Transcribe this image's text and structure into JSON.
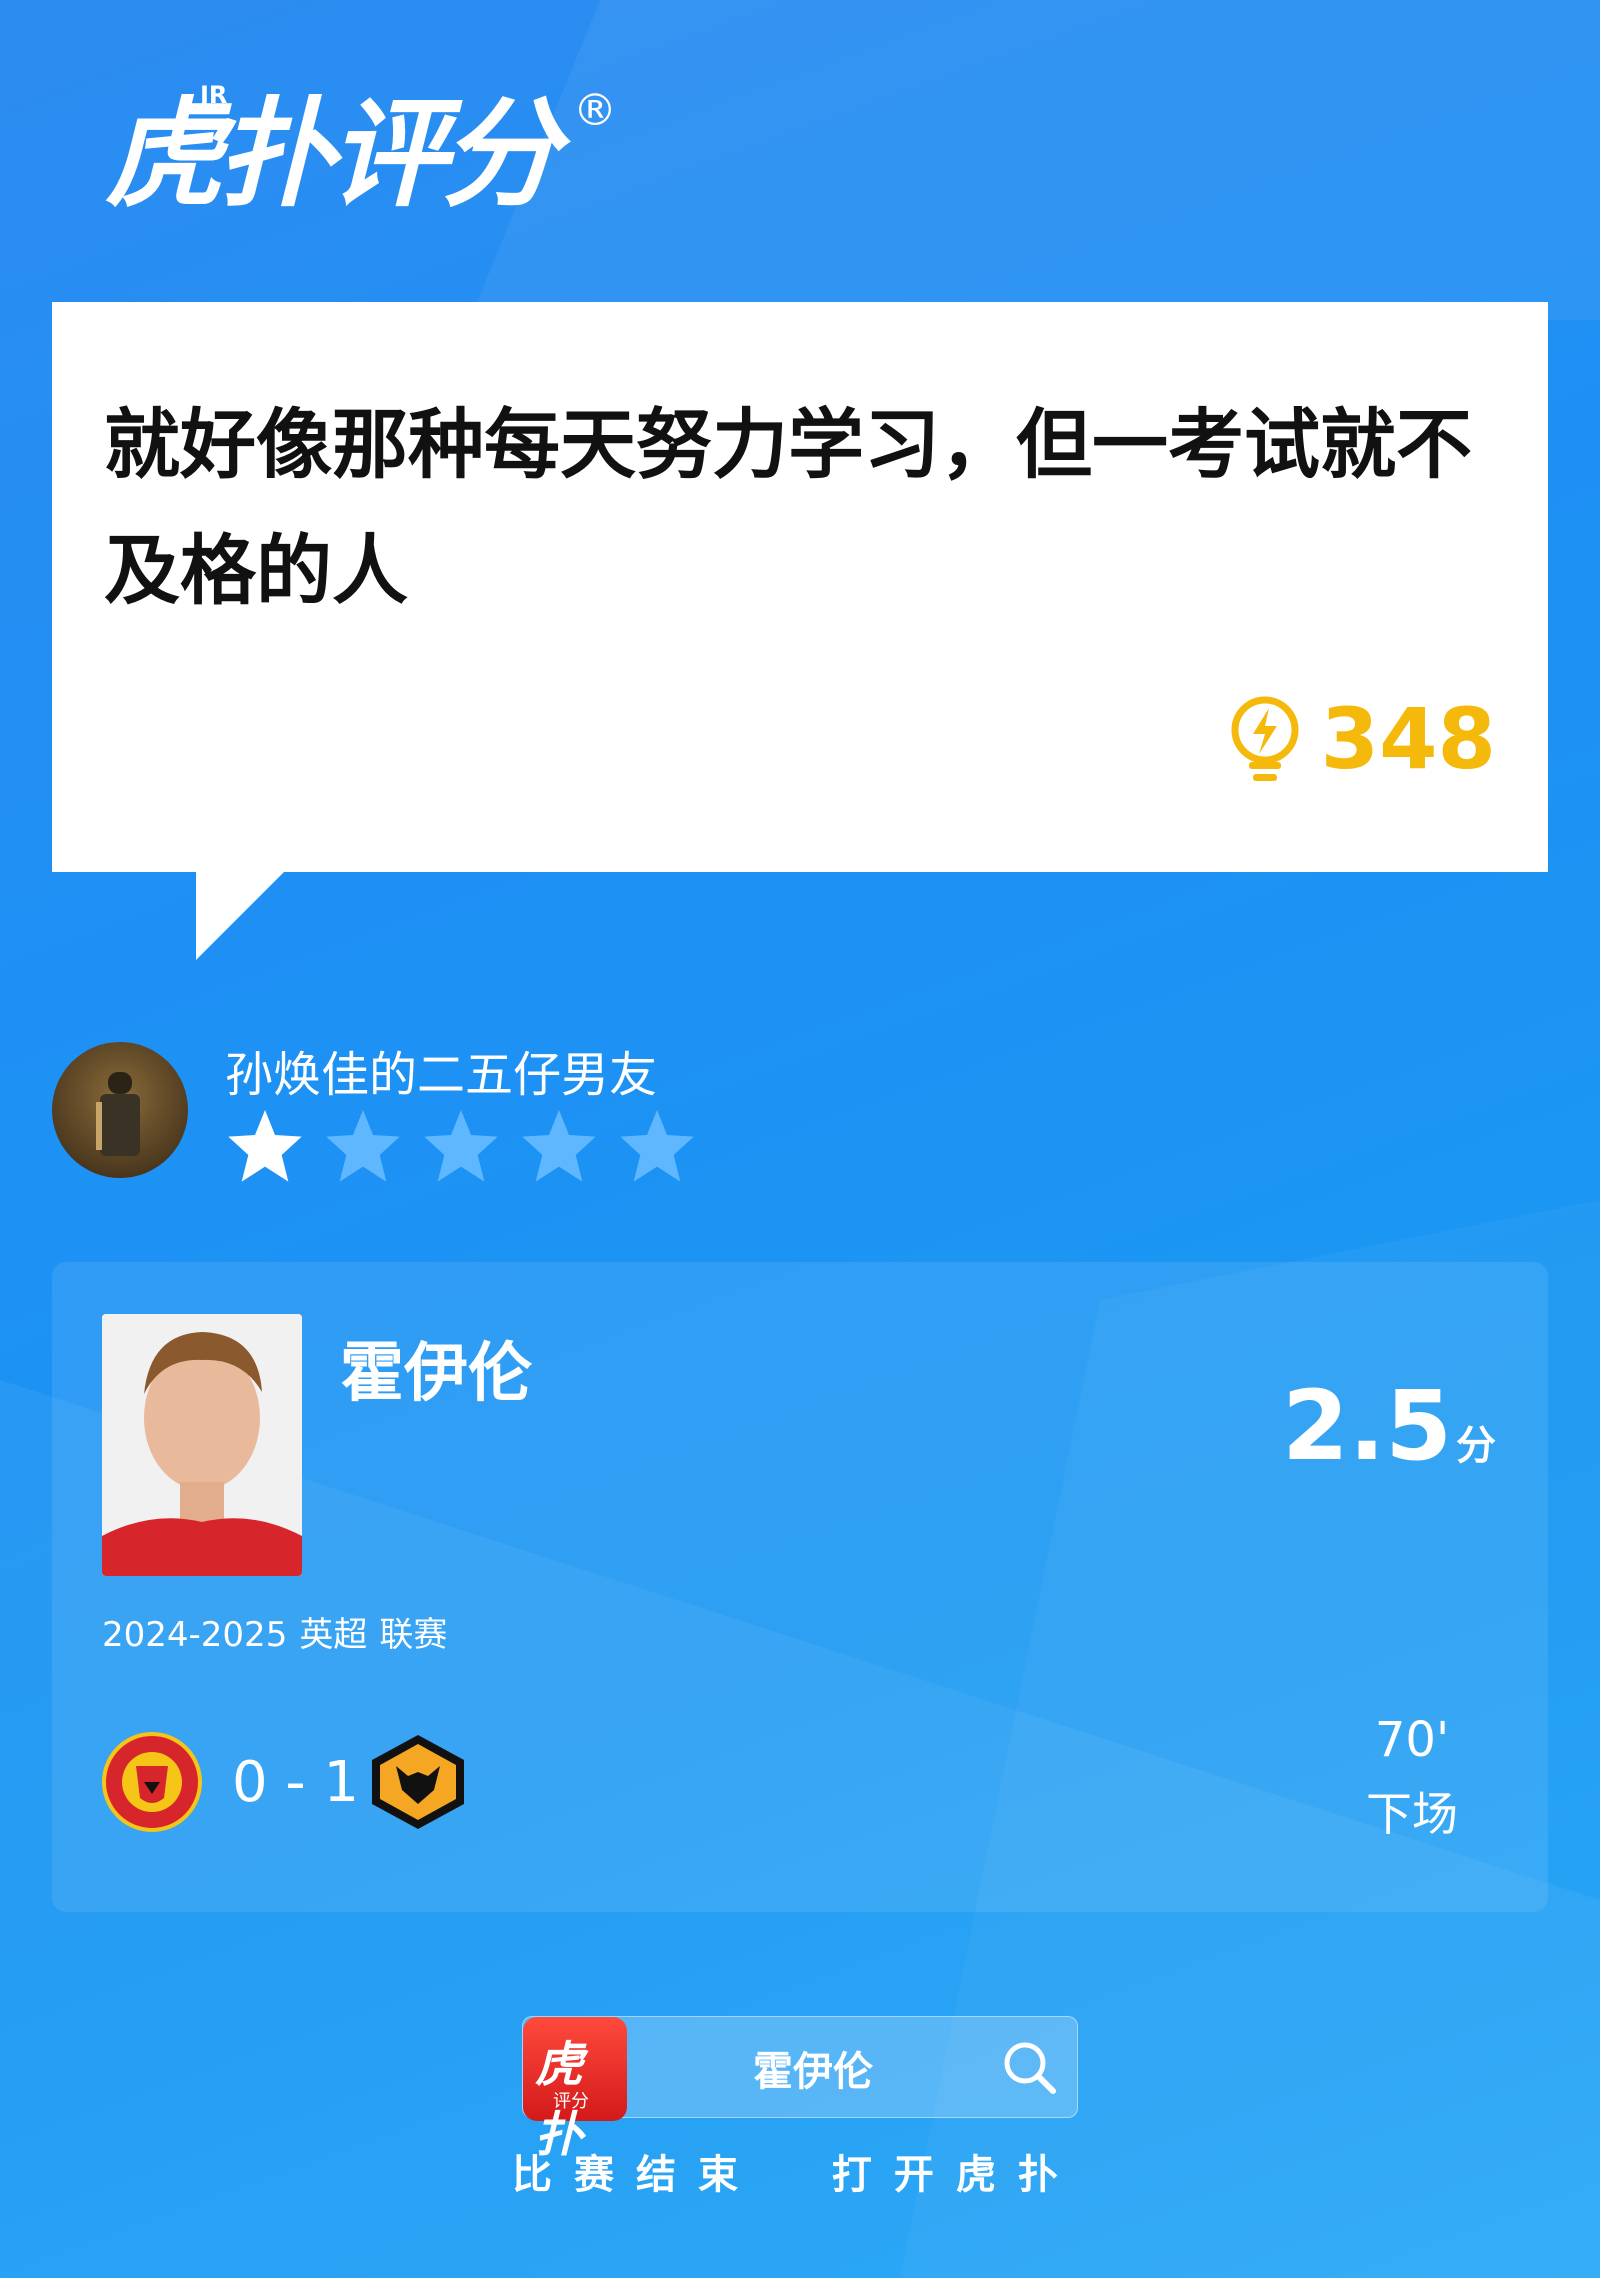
{
  "header": {
    "brand": "虎扑评分",
    "brand_mark": "JR",
    "registered": "®"
  },
  "comment": {
    "text": "就好像那种每天努力学习，但一考试就不及格的人",
    "likes": "348",
    "likes_icon": "lightbulb-icon"
  },
  "user": {
    "name": "孙焕佳的二五仔男友",
    "rating_stars": 1,
    "max_stars": 5
  },
  "player": {
    "name": "霍伊伦",
    "rating": "2.5",
    "rating_unit": "分",
    "season": "2024-2025",
    "league": "英超",
    "competition": "联赛",
    "home_team_icon": "manchester-united-crest",
    "score": "0 - 1",
    "away_team_icon": "wolves-crest",
    "minute": "70'",
    "status": "下场"
  },
  "search": {
    "app_icon_text": "虎扑",
    "app_icon_sub": "评分",
    "query": "霍伊伦"
  },
  "cta": "比赛结束  打开虎扑",
  "colors": {
    "accent": "#f5b90b",
    "background": "#1e90f5"
  }
}
